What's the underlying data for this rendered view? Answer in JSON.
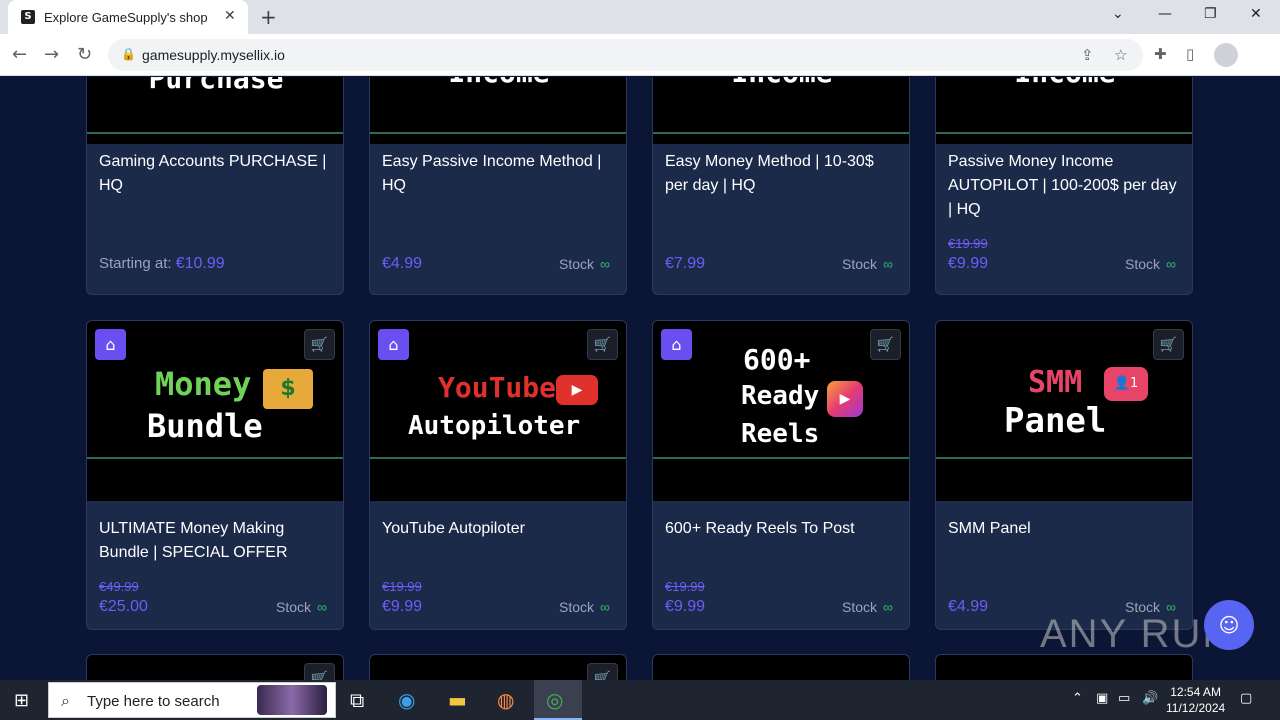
{
  "browser": {
    "tab_title": "Explore GameSupply's shop",
    "tab_favicon": "S",
    "url": "gamesupply.mysellix.io"
  },
  "top_row": [
    {
      "thumb_text": "Purchase",
      "name": "Gaming Accounts PURCHASE | HQ",
      "starting_label": "Starting at:",
      "price": "€10.99"
    },
    {
      "thumb_text": "Income",
      "name": "Easy Passive Income Method | HQ",
      "price": "€4.99",
      "stock": "Stock",
      "stock_symbol": "∞"
    },
    {
      "thumb_text": "Income",
      "name": "Easy Money Method | 10-30$ per day | HQ",
      "price": "€7.99",
      "stock": "Stock",
      "stock_symbol": "∞"
    },
    {
      "thumb_text": "Income",
      "name": "Passive Money Income AUTOPILOT | 100-200$ per day | HQ",
      "old_price": "€19.99",
      "price": "€9.99",
      "stock": "Stock",
      "stock_symbol": "∞"
    }
  ],
  "second_row": [
    {
      "thumb_line1": "Money",
      "thumb_line2": "Bundle",
      "name": "ULTIMATE Money Making Bundle | SPECIAL OFFER",
      "old_price": "€49.99",
      "price": "€25.00",
      "stock": "Stock",
      "stock_symbol": "∞"
    },
    {
      "thumb_line1": "YouTube",
      "thumb_line2": "Autopiloter",
      "name": "YouTube Autopiloter",
      "old_price": "€19.99",
      "price": "€9.99",
      "stock": "Stock",
      "stock_symbol": "∞"
    },
    {
      "thumb_line1": "600+",
      "thumb_line2": "Ready",
      "thumb_line3": "Reels",
      "name": "600+ Ready Reels To Post",
      "old_price": "€19.99",
      "price": "€9.99",
      "stock": "Stock",
      "stock_symbol": "∞"
    },
    {
      "thumb_line1": "SMM",
      "thumb_line2": "Panel",
      "name": "SMM Panel",
      "price": "€4.99",
      "stock": "Stock",
      "stock_symbol": "∞"
    }
  ],
  "watermark": "ANY RUN",
  "taskbar": {
    "search_placeholder": "Type here to search",
    "time": "12:54 AM",
    "date": "11/12/2024"
  },
  "colors": {
    "page_bg": "#0b1636",
    "card_bg": "#1c2a4a",
    "price": "#6f5cf7",
    "stock_infinity": "#2fb866",
    "tag_badge": "#6a4ff0"
  }
}
